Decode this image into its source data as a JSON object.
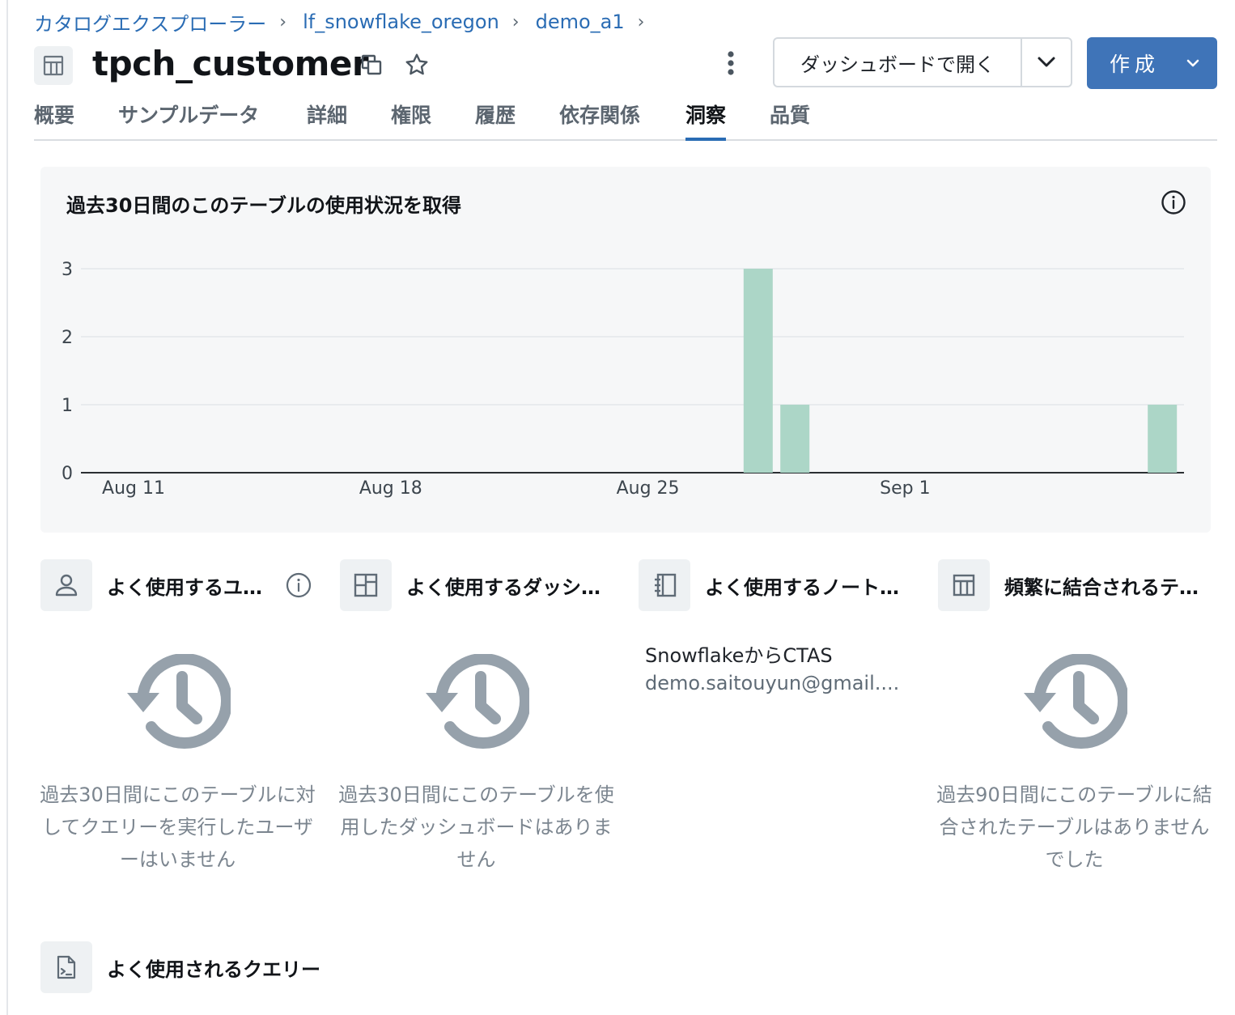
{
  "breadcrumb": {
    "items": [
      "カタログエクスプローラー",
      "lf_snowflake_oregon",
      "demo_a1"
    ],
    "separator": "›"
  },
  "header": {
    "title": "tpch_customer",
    "open_dashboard_label": "ダッシュボードで開く",
    "create_label": "作成"
  },
  "tabs": [
    {
      "label": "概要"
    },
    {
      "label": "サンプルデータ"
    },
    {
      "label": "詳細"
    },
    {
      "label": "権限"
    },
    {
      "label": "履歴"
    },
    {
      "label": "依存関係"
    },
    {
      "label": "洞察",
      "active": true
    },
    {
      "label": "品質"
    }
  ],
  "usage_card": {
    "title": "過去30日間のこのテーブルの使用状況を取得"
  },
  "chart_data": {
    "type": "bar",
    "title": "過去30日間のこのテーブルの使用状況を取得",
    "x_tick_labels": [
      "Aug 11",
      "Aug 18",
      "Aug 25",
      "Sep 1"
    ],
    "y_ticks": [
      0,
      1,
      2,
      3
    ],
    "ylim": [
      0,
      3
    ],
    "x": [
      "Aug 28",
      "Aug 29",
      "Sep 8"
    ],
    "values": [
      3,
      1,
      1
    ],
    "bar_color": "#acd6c7",
    "grid": true
  },
  "panels": {
    "users": {
      "title": "よく使用するユーザー",
      "empty_text": "過去30日間にこのテーブルに対してクエリーを実行したユーザーはいません"
    },
    "dashboards": {
      "title": "よく使用するダッシュボード",
      "empty_text": "過去30日間にこのテーブルを使用したダッシュボードはありません"
    },
    "notebooks": {
      "title": "よく使用するノートブック",
      "item_title": "SnowflakeからCTAS",
      "item_owner": "demo.saitouyun@gmail...."
    },
    "joined": {
      "title": "頻繁に結合されるテーブル",
      "empty_text": "過去90日間にこのテーブルに結合されたテーブルはありませんでした"
    }
  },
  "queries": {
    "title": "よく使用されるクエリー"
  },
  "colors": {
    "link": "#2a6cb4",
    "primary_button": "#3f74b8",
    "bar": "#acd6c7",
    "muted_text": "#7b858f",
    "icon_grey": "#96a1ab"
  }
}
